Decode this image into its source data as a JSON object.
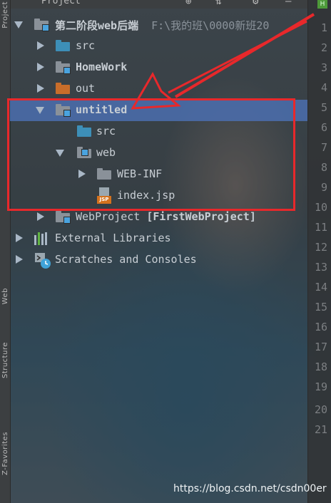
{
  "header": {
    "title": "Project",
    "mark": "H"
  },
  "left_strip": {
    "top_label": "Project",
    "bottom_labels": [
      "Web",
      "Structure",
      "Z-Favorites"
    ]
  },
  "tree": {
    "root": {
      "label": "第二阶段web后端",
      "path": "F:\\我的班\\0000新班20"
    },
    "items": [
      {
        "label": "src"
      },
      {
        "label": "HomeWork"
      },
      {
        "label": "out"
      },
      {
        "label": "untitled"
      },
      {
        "label": "src"
      },
      {
        "label": "web"
      },
      {
        "label": "WEB-INF"
      },
      {
        "label": "index.jsp",
        "badge": "JSP"
      },
      {
        "label": "WebProject",
        "suffix": "[FirstWebProject]"
      },
      {
        "label": "External Libraries"
      },
      {
        "label": "Scratches and Consoles"
      }
    ]
  },
  "gutter": {
    "line_numbers": [
      "1",
      "2",
      "3",
      "4",
      "5",
      "6",
      "7",
      "8",
      "9",
      "10",
      "11",
      "12",
      "13",
      "14",
      "15",
      "16",
      "17",
      "18",
      "19",
      "20",
      "21"
    ]
  },
  "colors": {
    "highlight": "#e8282b",
    "selected_row": "#4b6eaf",
    "folder_blue": "#3d8fb8",
    "folder_orange": "#c86d2a",
    "folder_gray": "#8a9199"
  },
  "watermark": "https://blog.csdn.net/csdn00er"
}
